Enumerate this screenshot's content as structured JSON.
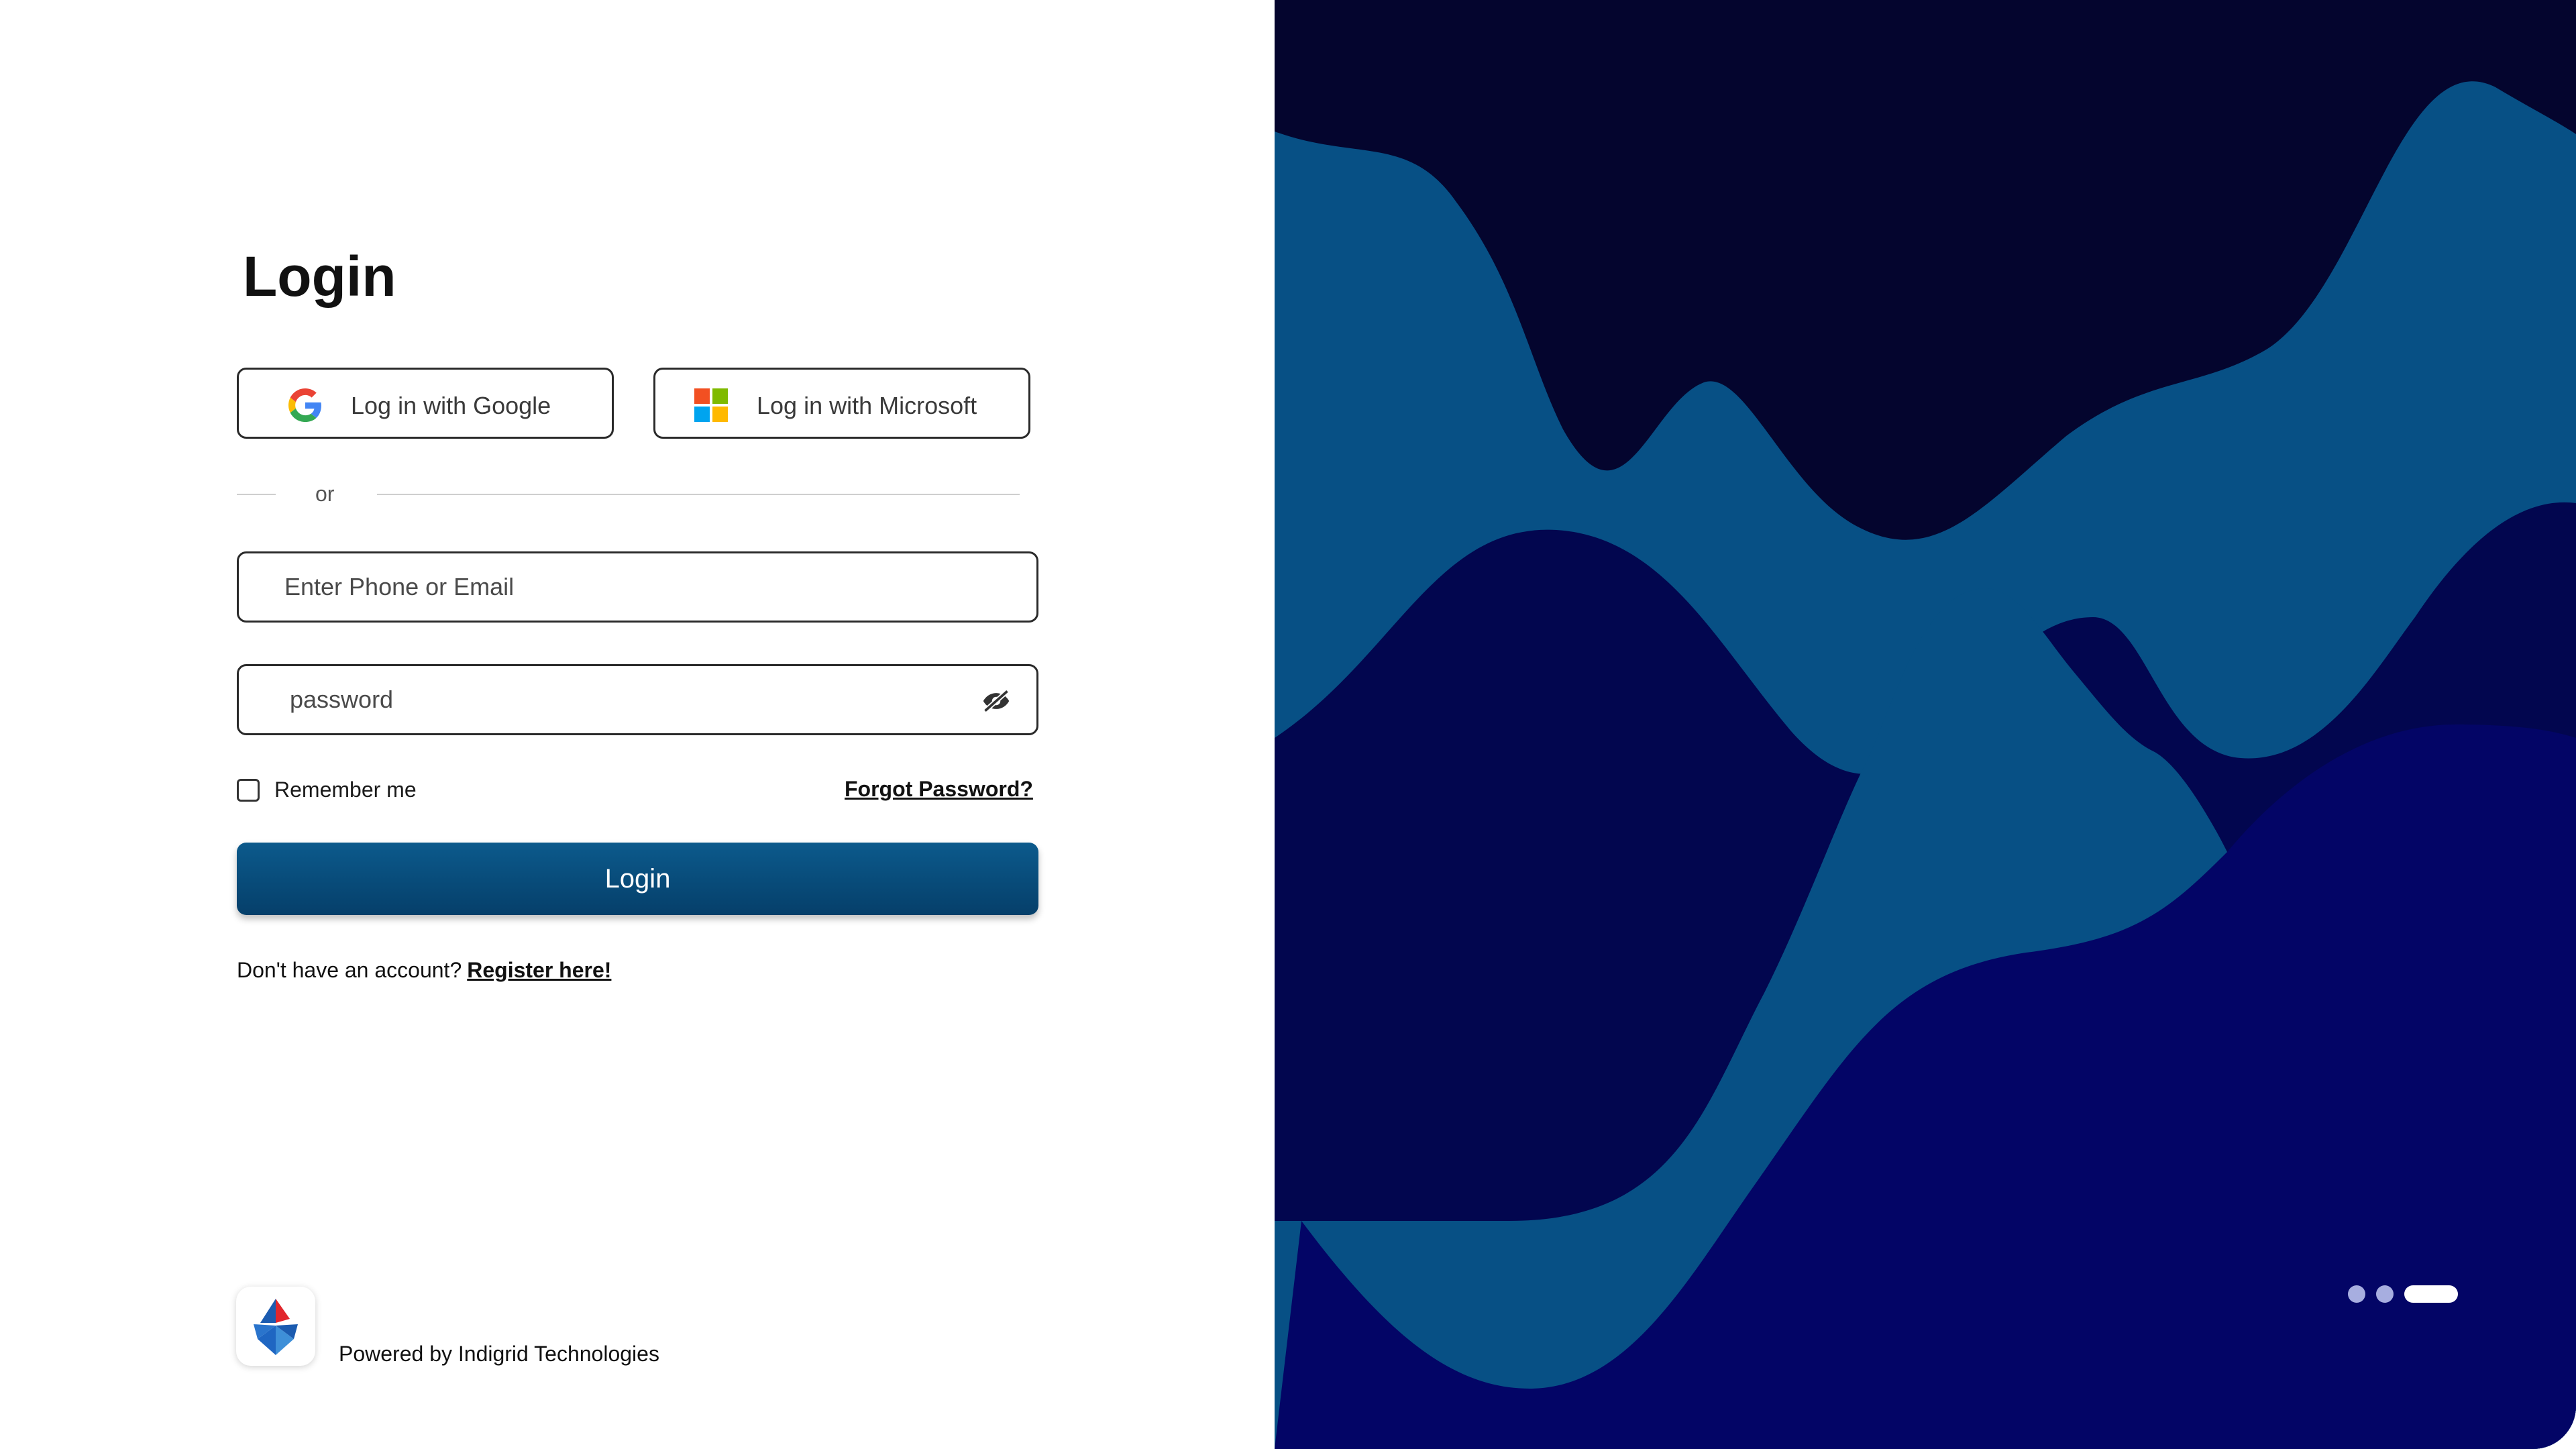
{
  "title": "Login",
  "sso": {
    "google_label": "Log in with Google",
    "microsoft_label": "Log in with Microsoft"
  },
  "divider_text": "or",
  "email_field": {
    "placeholder": "Enter Phone or Email"
  },
  "password_field": {
    "placeholder": "password"
  },
  "remember_label": "Remember me",
  "forgot_label": "Forgot Password?",
  "login_button_label": "Login",
  "register": {
    "prompt": "Don't have an account?",
    "link": "Register here!"
  },
  "footer": {
    "powered_by": "Powered by Indigrid Technologies"
  },
  "carousel": {
    "count": 3,
    "active_index": 2
  },
  "colors": {
    "primary_button": "#0b5283",
    "panel_dark": "#04052e",
    "panel_teal": "#075085",
    "panel_navy": "#030566"
  }
}
